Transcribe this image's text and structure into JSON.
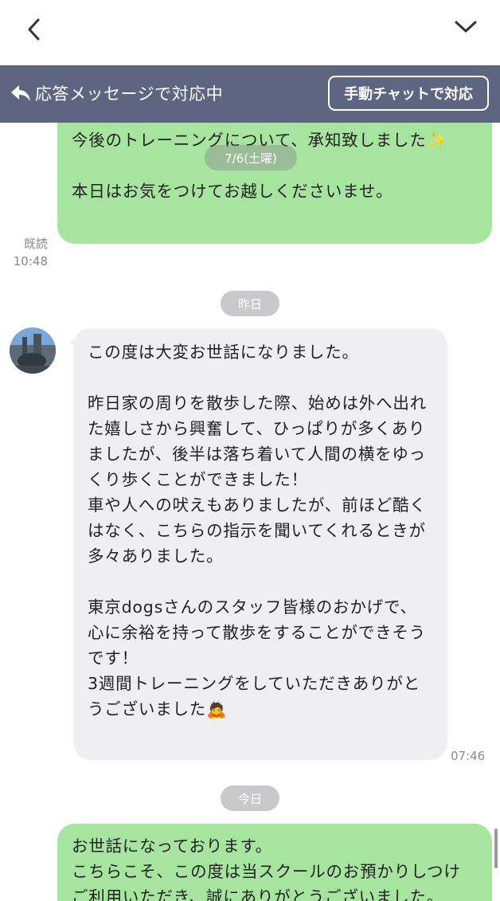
{
  "nav": {
    "back_icon": "chevron-left-icon",
    "collapse_icon": "chevron-down-icon"
  },
  "auto_reply": {
    "icon": "reply-arrow-icon",
    "status_text": "応答メッセージで対応中",
    "manual_button_label": "手動チャットで対応"
  },
  "messages": [
    {
      "sender": "me",
      "text": "今後のトレーニングについて、承知致しました✨\n\n本日はお気をつけてお越しくださいませ。",
      "read_label": "既読",
      "time": "10:48"
    },
    {
      "sender": "other",
      "text": "この度は大変お世話になりました。\n\n昨日家の周りを散歩した際、始めは外へ出れた嬉しさから興奮して、ひっぱりが多くありましたが、後半は落ち着いて人間の横をゆっくり歩くことができました！\n車や人への吠えもありましたが、前ほど酷くはなく、こちらの指示を聞いてくれるときが多々ありました。\n\n東京dogsさんのスタッフ皆様のおかげで、心に余裕を持って散歩をすることができそうです！\n3週間トレーニングをしていただきありがとうございました🙇",
      "time": "07:46"
    },
    {
      "sender": "me",
      "text": "お世話になっております。\nこちらこそ、この度は当スクールのお預かりしつけご利用いただき、誠にありがとうございました。"
    }
  ],
  "dates": {
    "floating": "7/6(土曜)",
    "yesterday": "昨日",
    "today": "今日"
  },
  "colors": {
    "banner_bg": "#5e6580",
    "my_bubble": "#a7e4a0",
    "their_bubble": "#efeff1"
  }
}
